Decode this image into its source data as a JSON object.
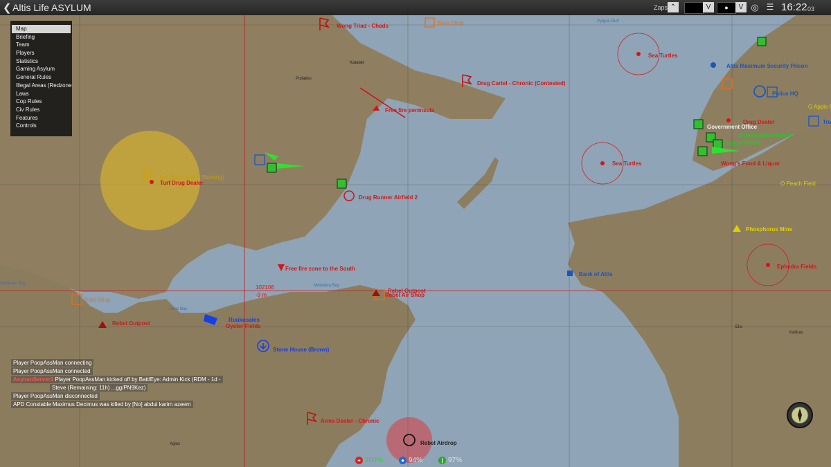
{
  "topbar": {
    "title": "Altis Life ASYLUM",
    "zaps_label": "Zaps",
    "time": "16:22",
    "seconds": "03"
  },
  "menu": {
    "items": [
      "Map",
      "Briefing",
      "Team",
      "Players",
      "Statistics",
      "Gaming Asylum",
      "General Rules",
      "Illegal Areas (Redzones)",
      "Laws",
      "Cop Rules",
      "Civ Rules",
      "Features",
      "Controls"
    ],
    "selected": "Map"
  },
  "chat": [
    {
      "text": "Player PoopAssMan connecting"
    },
    {
      "text": "Player PoopAssMan connected"
    },
    {
      "tag": "AsylumServer1",
      "text": "Player PoopAssMan kicked off by BattlEye: Admin Kick (RDM - 1d -"
    },
    {
      "text": "Steve (Remaining: 11h) ...gg/PN9Kez)"
    },
    {
      "text": "Player PoopAssMan disconnected"
    },
    {
      "text": "APD Constable Maximus Decimus was killed by [No] abdul karim azeem"
    }
  ],
  "status": {
    "health": "100%",
    "water": "94%",
    "food": "97%",
    "health_color": "#22dd22",
    "water_color": "#e0e0e0",
    "food_color": "#e0e0e0"
  },
  "cursor": {
    "grid": "102106",
    "elevation": "-9 m"
  },
  "markers": {
    "wong_triad": "Wong Triad - Chads",
    "beer_shop_1": "Beer Shop",
    "sea_turtles_1": "Sea Turtles",
    "sea_turtles_2": "Sea Turtles",
    "altis_prison": "Altis Maximum Security Prison",
    "apple_field": "O Apple Fi",
    "truck": "Tru",
    "police_hq": "Police HQ",
    "drug_cartel": "Drug Cartel - Chronic (Contested)",
    "free_fire_peninsula": "Free fire peninsula",
    "drug_dealer": "Drug Dealer",
    "government_office": "Government Office",
    "commodities_trader": "Commodities Trader",
    "general_store": "General Store",
    "wongs_food": "Wong's Food & Liquor",
    "peach_field": "O Peach Field",
    "turf_drug_dealer": "Turf Drug Dealer",
    "turf_flag": "Turf Drug Dealer (Burning)",
    "drug_runner": "Drug Runner Airfield 2",
    "phosphorus_mine": "Phosphorus Mine",
    "free_fire_south": "Free fire zone to the South",
    "ephedra_fields": "Ephedra Fields",
    "bank_of_altis": "Bank of Altis",
    "rebel_outpost_1": "Rebel Outpost",
    "rebel_air_shop": "Rebel Air Shop",
    "boat_shop": "Boat Shop",
    "rebel_outpost_2": "Rebel Outpost",
    "oyster_fields": "Oyster Fields",
    "stone_house": "Stone House (Brown)",
    "arms_dealer": "Arms Dealer - Chronic",
    "rebel_airdrop": "Rebel Airdrop",
    "player_name": "Ruukosales"
  },
  "places": {
    "kataliki": "Katalaki",
    "poliakko": "Poliakko",
    "zaros_bay": "Zaros Bay",
    "selakano_bay": "Selakano Bay",
    "melanera_bay": "Melanera Bay",
    "pyrgos": "Pyrgos Gulf",
    "eginio": "Eginio",
    "agios": "Agios",
    "elotia": "Eloi",
    "kalliras": "Kalliras"
  },
  "colors": {
    "sea": "#8fa4b6",
    "land": "#8a7a5c",
    "turf_zone": "#e8c020",
    "red_zone": "#cc2020",
    "player": "#1540e8",
    "green_marker": "#30c030"
  }
}
